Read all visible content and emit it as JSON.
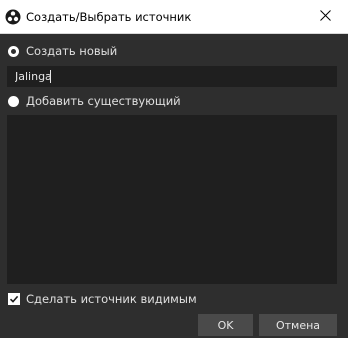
{
  "window": {
    "title": "Создать/Выбрать источник",
    "app_icon": "obs-logo-icon",
    "close_icon": "close-icon"
  },
  "options": {
    "create_new_label": "Создать новый",
    "create_new_selected": true,
    "add_existing_label": "Добавить существующий",
    "add_existing_selected": false
  },
  "name_input": {
    "value": "Jalinga"
  },
  "existing_sources": {
    "items": []
  },
  "visibility": {
    "label": "Сделать источник видимым",
    "checked": true
  },
  "buttons": {
    "ok_label": "OK",
    "cancel_label": "Отмена"
  },
  "colors": {
    "background": "#2e2e2e",
    "field_background": "#1f1f1f",
    "button_background": "#4a4a4a"
  }
}
